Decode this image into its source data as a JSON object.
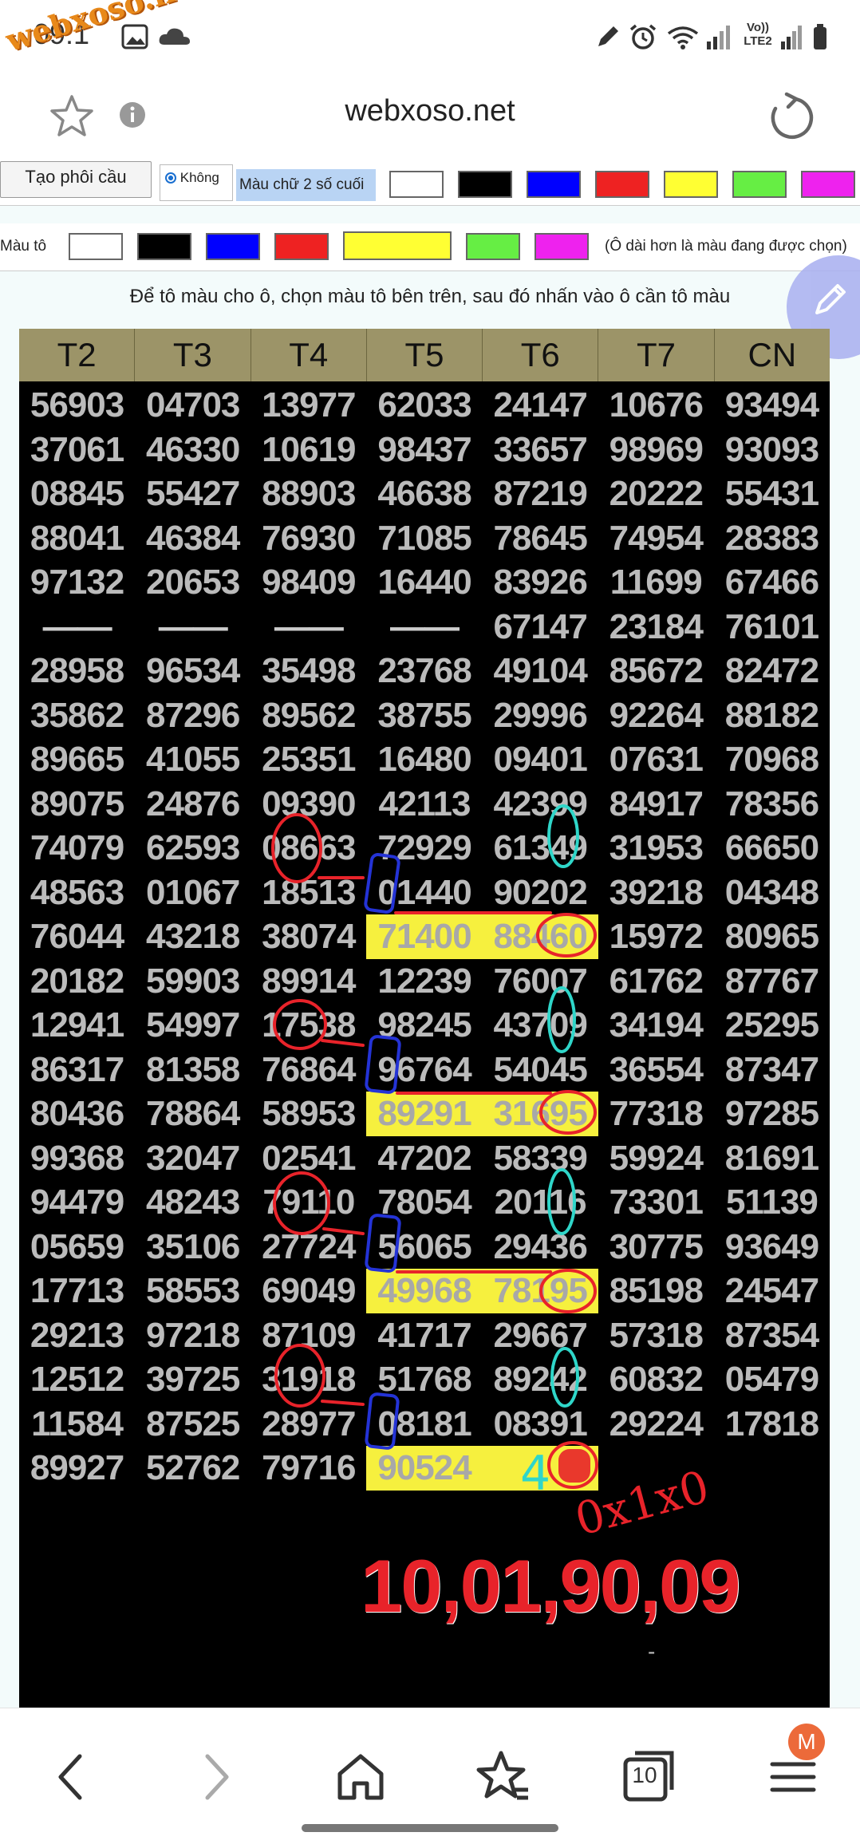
{
  "status_bar": {
    "time": "09:1",
    "network": "Vo)) LTE2"
  },
  "watermark": "webxoso.net",
  "browser": {
    "url": "webxoso.net",
    "tab_count": "10",
    "avatar_initial": "M"
  },
  "toolbar": {
    "create_button": "Tạo phôi cầu",
    "radio_label": "Không",
    "last2_label": "Màu chữ 2 số cuối",
    "fill_label": "Màu tô",
    "longer_note": "(Ô dài hơn là màu đang được chọn)",
    "instruction": "Để tô màu cho ô, chọn màu tô bên trên, sau đó nhấn vào ô cần tô màu",
    "colors": [
      "#ffffff",
      "#000000",
      "#0000ff",
      "#ee2222",
      "#ffff33",
      "#66ee44",
      "#ee22ee"
    ]
  },
  "table": {
    "headers": [
      "T2",
      "T3",
      "T4",
      "T5",
      "T6",
      "T7",
      "CN"
    ],
    "rows": [
      [
        "56903",
        "04703",
        "13977",
        "62033",
        "24147",
        "10676",
        "93494"
      ],
      [
        "37061",
        "46330",
        "10619",
        "98437",
        "33657",
        "98969",
        "93093"
      ],
      [
        "08845",
        "55427",
        "88903",
        "46638",
        "87219",
        "20222",
        "55431"
      ],
      [
        "88041",
        "46384",
        "76930",
        "71085",
        "78645",
        "74954",
        "28383"
      ],
      [
        "97132",
        "20653",
        "98409",
        "16440",
        "83926",
        "11699",
        "67466"
      ],
      [
        "——",
        "——",
        "——",
        "——",
        "67147",
        "23184",
        "76101"
      ],
      [
        "28958",
        "96534",
        "35498",
        "23768",
        "49104",
        "85672",
        "82472"
      ],
      [
        "35862",
        "87296",
        "89562",
        "38755",
        "29996",
        "92264",
        "88182"
      ],
      [
        "89665",
        "41055",
        "25351",
        "16480",
        "09401",
        "07631",
        "70968"
      ],
      [
        "89075",
        "24876",
        "09390",
        "42113",
        "42399",
        "84917",
        "78356"
      ],
      [
        "74079",
        "62593",
        "08663",
        "72929",
        "61349",
        "31953",
        "66650"
      ],
      [
        "48563",
        "01067",
        "18513",
        "01440",
        "90202",
        "39218",
        "04348"
      ],
      [
        "76044",
        "43218",
        "38074",
        "71400",
        "88460",
        "15972",
        "80965"
      ],
      [
        "20182",
        "59903",
        "89914",
        "12239",
        "76007",
        "61762",
        "87767"
      ],
      [
        "12941",
        "54997",
        "17538",
        "98245",
        "43709",
        "34194",
        "25295"
      ],
      [
        "86317",
        "81358",
        "76864",
        "96764",
        "54045",
        "36554",
        "87347"
      ],
      [
        "80436",
        "78864",
        "58953",
        "89291",
        "31695",
        "77318",
        "97285"
      ],
      [
        "99368",
        "32047",
        "02541",
        "47202",
        "58339",
        "59924",
        "81691"
      ],
      [
        "94479",
        "48243",
        "79110",
        "78054",
        "20116",
        "73301",
        "51139"
      ],
      [
        "05659",
        "35106",
        "27724",
        "56065",
        "29436",
        "30775",
        "93649"
      ],
      [
        "17713",
        "58553",
        "69049",
        "49968",
        "78195",
        "85198",
        "24547"
      ],
      [
        "29213",
        "97218",
        "87109",
        "41717",
        "29667",
        "57318",
        "87354"
      ],
      [
        "12512",
        "39725",
        "31918",
        "51768",
        "89242",
        "60832",
        "05479"
      ],
      [
        "11584",
        "87525",
        "28977",
        "08181",
        "08391",
        "29224",
        "17818"
      ],
      [
        "89927",
        "52762",
        "79716",
        "90524",
        "",
        "",
        ""
      ]
    ],
    "highlighted": [
      [
        12,
        3
      ],
      [
        12,
        4
      ],
      [
        16,
        3
      ],
      [
        16,
        4
      ],
      [
        20,
        3
      ],
      [
        20,
        4
      ],
      [
        24,
        3
      ],
      [
        24,
        4
      ]
    ]
  },
  "annotations": {
    "result": "10,01,90,09",
    "handwritten_top": "0x1x0",
    "handwritten_digit": "4",
    "small_mark": "-",
    "colors": {
      "red": "#e8232a",
      "blue": "#2433d6",
      "cyan": "#2fd6c9",
      "highlight": "#f6f03e"
    }
  }
}
